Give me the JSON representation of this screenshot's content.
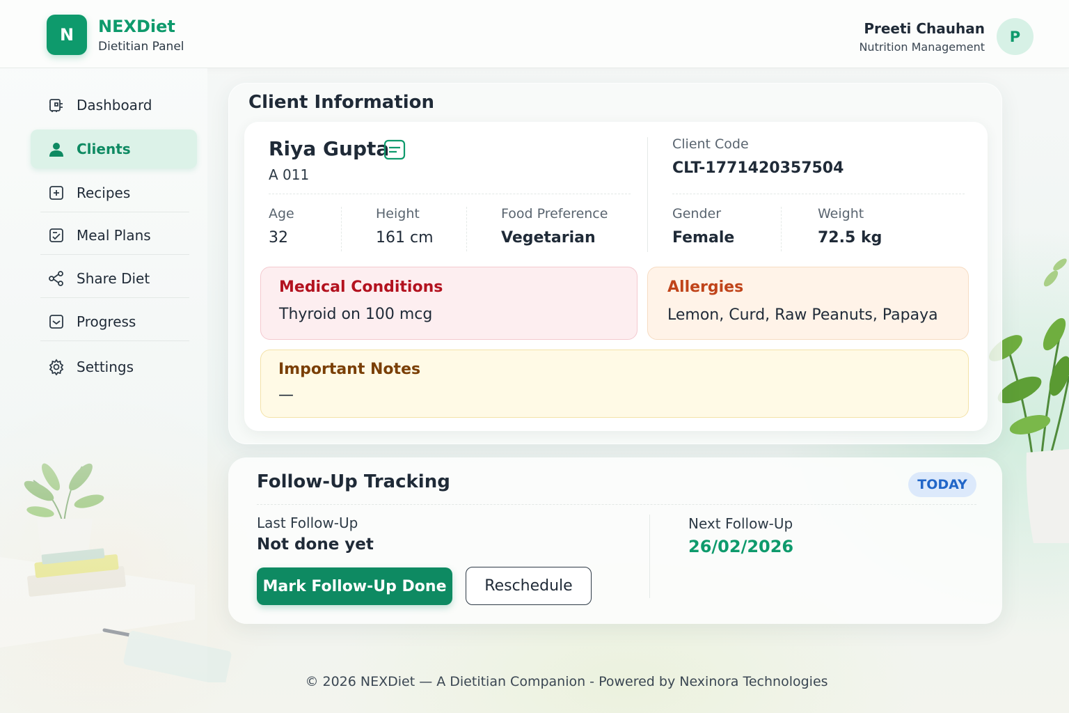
{
  "header": {
    "logo_letter": "N",
    "brand_name": "NEXDiet",
    "brand_subtitle": "Dietitian Panel",
    "user_name": "Preeti Chauhan",
    "user_role": "Nutrition Management",
    "user_initial": "P"
  },
  "sidebar": {
    "items": [
      {
        "label": "Dashboard",
        "icon": "dashboard-icon"
      },
      {
        "label": "Clients",
        "icon": "user-icon",
        "active": true
      },
      {
        "label": "Recipes",
        "icon": "plus-square-icon"
      },
      {
        "label": "Meal Plans",
        "icon": "meal-plan-icon"
      },
      {
        "label": "Share Diet",
        "icon": "share-icon"
      },
      {
        "label": "Progress",
        "icon": "progress-icon"
      },
      {
        "label": "Settings",
        "icon": "gear-icon"
      }
    ]
  },
  "client_info": {
    "section_title": "Client Information",
    "name": "Riya Gupta",
    "sub_id": "A 011",
    "client_code_label": "Client Code",
    "client_code": "CLT-1771420357504",
    "age_label": "Age",
    "age": "32",
    "height_label": "Height",
    "height": "161 cm",
    "food_pref_label": "Food Preference",
    "food_pref": "Vegetarian",
    "gender_label": "Gender",
    "gender": "Female",
    "weight_label": "Weight",
    "weight": "72.5 kg",
    "medical_title": "Medical Conditions",
    "medical_text": "Thyroid on 100 mcg",
    "allergies_title": "Allergies",
    "allergies_text": "Lemon, Curd, Raw Peanuts, Papaya",
    "notes_title": "Important Notes",
    "notes_text": "—"
  },
  "followup": {
    "title": "Follow-Up Tracking",
    "badge": "TODAY",
    "last_label": "Last Follow-Up",
    "last_value": "Not done yet",
    "next_label": "Next Follow-Up",
    "next_value": "26/02/2026",
    "mark_done_label": "Mark Follow-Up Done",
    "reschedule_label": "Reschedule"
  },
  "footer": {
    "text": "© 2026 NEXDiet — A Dietitian Companion - Powered by Nexinora Technologies"
  },
  "colors": {
    "brand": "#0e9a6c",
    "accent_dark": "#0e8a62",
    "medical_title": "#b3121f",
    "allergies_title": "#c0441a",
    "notes_title": "#7a3f06",
    "badge_bg": "#dce9fb",
    "badge_text": "#2166c8"
  }
}
